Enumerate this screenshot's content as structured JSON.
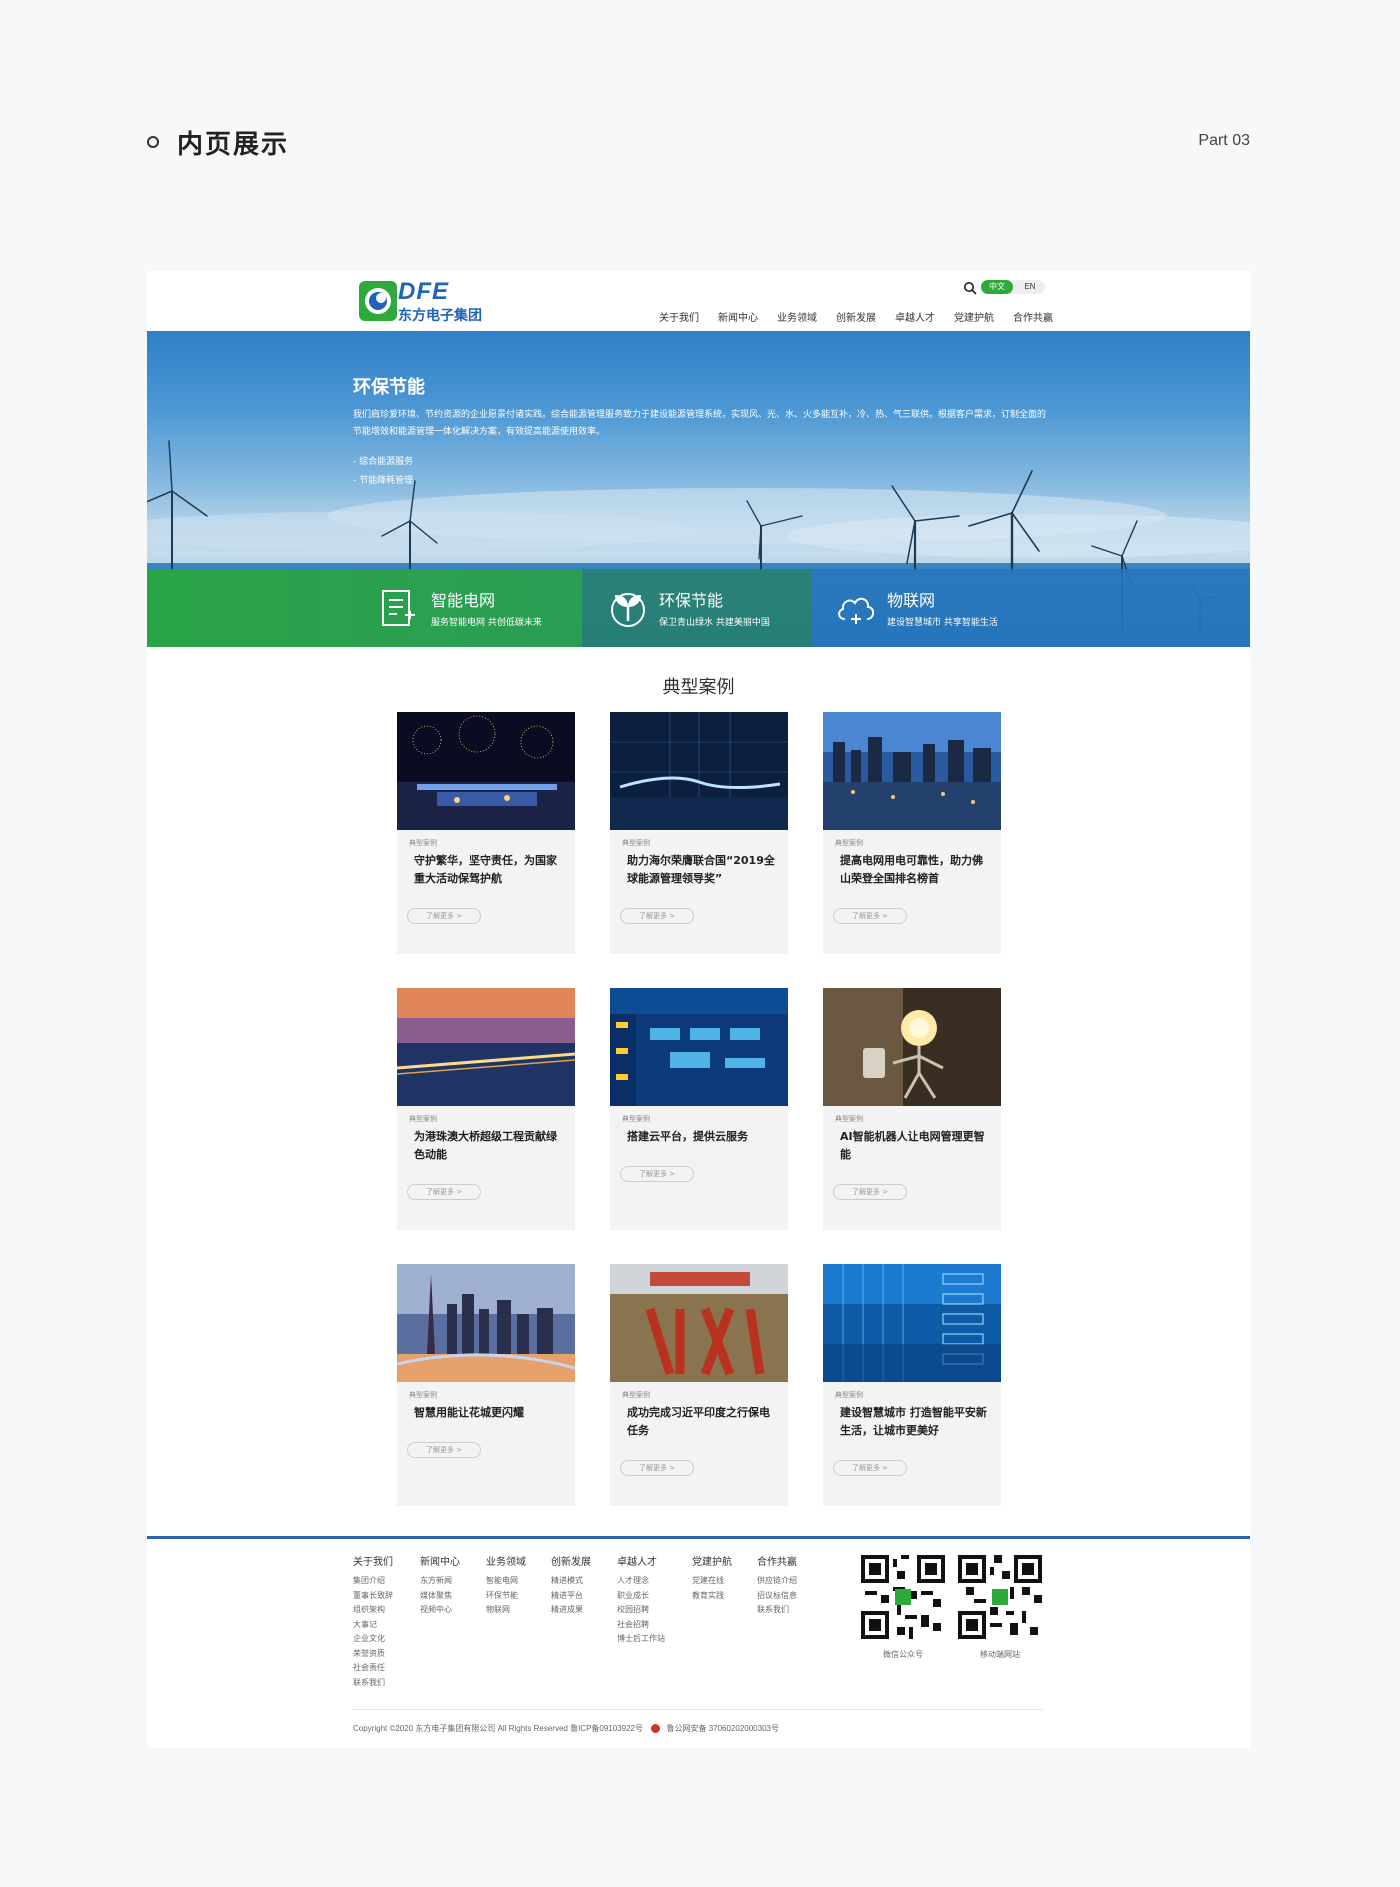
{
  "presentation": {
    "title": "内页展示",
    "part": "Part 03"
  },
  "site": {
    "logo": {
      "en": "DFE",
      "cn": "东方电子集团"
    },
    "lang": {
      "cn": "中文",
      "en": "EN"
    },
    "nav": [
      "关于我们",
      "新闻中心",
      "业务领域",
      "创新发展",
      "卓越人才",
      "党建护航",
      "合作共赢"
    ],
    "banner": {
      "title": "环保节能",
      "description": "我们肩珍爱环境、节约资源的企业愿景付诸实践。综合能源管理服务致力于建设能源管理系统，实现风、光、水、火多能互补，冷、热、气三联供。根据客户需求，订制全面的节能增效和能源管理一体化解决方案，有效提高能源使用效率。",
      "list": [
        "- 综合能源服务",
        "- 节能降耗管理"
      ]
    },
    "features": [
      {
        "title": "智能电网",
        "subtitle": "服务智能电网 共创低碳未来"
      },
      {
        "title": "环保节能",
        "subtitle": "保卫青山绿水 共建美丽中国"
      },
      {
        "title": "物联网",
        "subtitle": "建设智慧城市 共享智能生活"
      }
    ],
    "cases_title": "典型案例",
    "cases": [
      {
        "tag": "典型案例",
        "title": "守护繁华，坚守责任，为国家重大活动保驾护航",
        "button": "了解更多 >"
      },
      {
        "tag": "典型案例",
        "title": "助力海尔荣膺联合国“2019全球能源管理领导奖”",
        "button": "了解更多 >"
      },
      {
        "tag": "典型案例",
        "title": "提高电网用电可靠性，助力佛山荣登全国排名榜首",
        "button": "了解更多 >"
      },
      {
        "tag": "典型案例",
        "title": "为港珠澳大桥超级工程贡献绿色动能",
        "button": "了解更多 >"
      },
      {
        "tag": "典型案例",
        "title": "搭建云平台，提供云服务",
        "button": "了解更多 >"
      },
      {
        "tag": "典型案例",
        "title": "AI智能机器人让电网管理更智能",
        "button": "了解更多 >"
      },
      {
        "tag": "典型案例",
        "title": "智慧用能让花城更闪耀",
        "button": "了解更多 >"
      },
      {
        "tag": "典型案例",
        "title": "成功完成习近平印度之行保电任务",
        "button": "了解更多 >"
      },
      {
        "tag": "典型案例",
        "title": "建设智慧城市 打造智能平安新生活，让城市更美好",
        "button": "了解更多 >"
      }
    ],
    "footer": {
      "columns": [
        {
          "title": "关于我们",
          "links": [
            "集团介绍",
            "董事长致辞",
            "组织架构",
            "大事记",
            "企业文化",
            "荣誉资质",
            "社会责任",
            "联系我们"
          ]
        },
        {
          "title": "新闻中心",
          "links": [
            "东方新闻",
            "媒体聚焦",
            "视频中心"
          ]
        },
        {
          "title": "业务领域",
          "links": [
            "智能电网",
            "环保节能",
            "物联网"
          ]
        },
        {
          "title": "创新发展",
          "links": [
            "精进模式",
            "精进平台",
            "精进成果"
          ]
        },
        {
          "title": "卓越人才",
          "links": [
            "人才理念",
            "职业成长",
            "校园招聘",
            "社会招聘",
            "博士后工作站"
          ]
        },
        {
          "title": "党建护航",
          "links": [
            "党建在线",
            "教育实践"
          ]
        },
        {
          "title": "合作共赢",
          "links": [
            "供应链介绍",
            "招议标信息",
            "联系我们"
          ]
        }
      ],
      "qr": [
        {
          "label": "微信公众号"
        },
        {
          "label": "移动端网站"
        }
      ],
      "copyright": "Copyright ©2020 东方电子集团有限公司 All Rights Reserved 鲁ICP备09103922号",
      "police": "鲁公网安备 37060202000303号"
    }
  }
}
